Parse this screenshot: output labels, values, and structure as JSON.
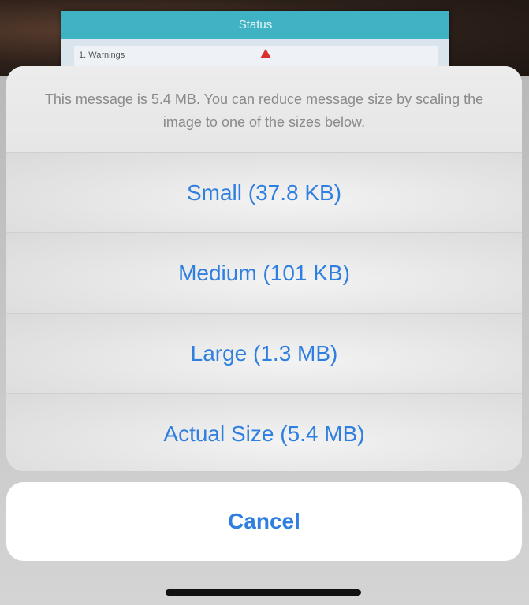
{
  "background": {
    "screen_header": "Status",
    "screen_row_label": "1. Warnings"
  },
  "sheet": {
    "message": "This message is 5.4 MB. You can reduce message size by scaling the image to one of the sizes below.",
    "options": [
      {
        "label": "Small (37.8 KB)"
      },
      {
        "label": "Medium (101 KB)"
      },
      {
        "label": "Large (1.3 MB)"
      },
      {
        "label": "Actual Size (5.4 MB)"
      }
    ],
    "cancel_label": "Cancel"
  },
  "colors": {
    "accent": "#2f7fe0",
    "message_text": "#8a8a8a",
    "sheet_bg": "#ececec",
    "warning": "#d9302f"
  },
  "icons": {
    "warning": "warning-triangle-icon"
  }
}
